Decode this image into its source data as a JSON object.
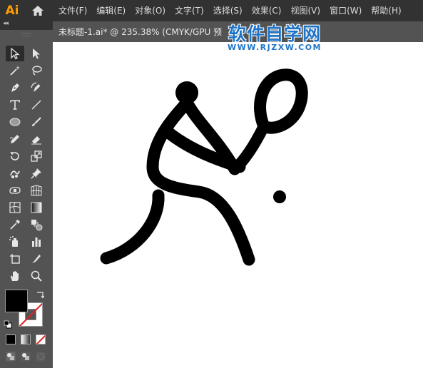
{
  "app": {
    "logo": "Ai"
  },
  "menu": {
    "items": [
      "文件(F)",
      "编辑(E)",
      "对象(O)",
      "文字(T)",
      "选择(S)",
      "效果(C)",
      "视图(V)",
      "窗口(W)",
      "帮助(H)"
    ]
  },
  "panel": {
    "collapse_label": "◂◂"
  },
  "document": {
    "tab_title": "未标题-1.ai* @ 235.38% (CMYK/GPU 预"
  },
  "watermark": {
    "main": "软件自学网",
    "url": "WWW.RJZXW.COM"
  },
  "colors": {
    "accent": "#ff9a00",
    "watermark": "#1e74c7",
    "fill": "#000000",
    "stroke_none": "#e02020"
  },
  "tools": [
    "selection-tool",
    "direct-selection-tool",
    "magic-wand-tool",
    "lasso-tool",
    "pen-tool",
    "curvature-tool",
    "type-tool",
    "line-segment-tool",
    "ellipse-tool",
    "paintbrush-tool",
    "pencil-tool",
    "eraser-tool",
    "rotate-tool",
    "scale-tool",
    "puppet-warp-tool",
    "pin-tool",
    "free-transform-tool",
    "perspective-grid-tool",
    "mesh-tool",
    "gradient-tool",
    "eyedropper-tool",
    "blend-tool",
    "symbol-sprayer-tool",
    "column-graph-tool",
    "artboard-tool",
    "slice-tool",
    "hand-tool",
    "zoom-tool"
  ]
}
